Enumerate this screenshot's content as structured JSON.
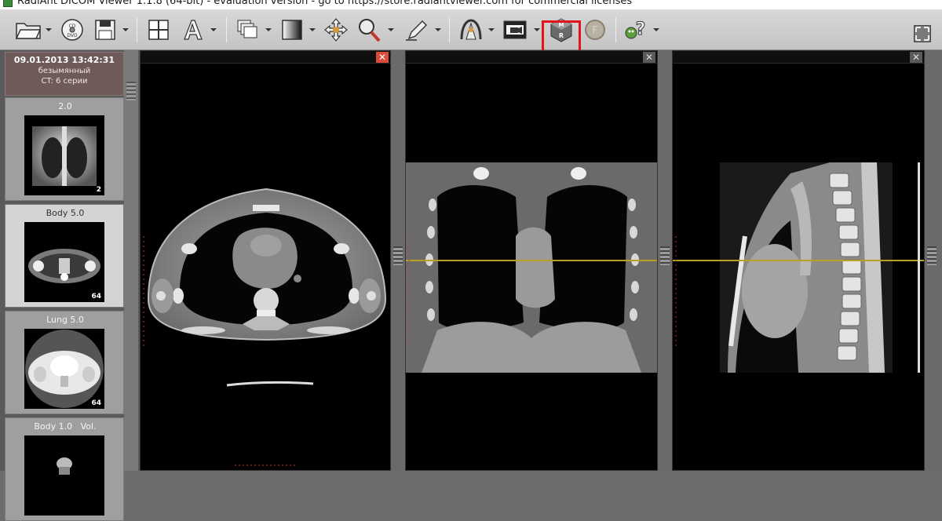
{
  "window": {
    "title": "RadiAnt DICOM Viewer 1.1.8 (64-bit) - evaluation version - go to https://store.radiantviewer.com for commercial licenses"
  },
  "toolbar": {
    "tools": [
      {
        "name": "open",
        "icon": "folder-icon"
      },
      {
        "name": "cd-dvd",
        "icon": "cd-dvd-icon"
      },
      {
        "name": "save",
        "icon": "floppy-icon"
      },
      {
        "name": "layout",
        "icon": "grid-layout-icon"
      },
      {
        "name": "annotation",
        "icon": "text-a-icon"
      },
      {
        "name": "series",
        "icon": "stack-icon"
      },
      {
        "name": "window-level",
        "icon": "gradient-icon"
      },
      {
        "name": "pan",
        "icon": "pan-arrows-icon"
      },
      {
        "name": "zoom",
        "icon": "magnifier-icon"
      },
      {
        "name": "draw",
        "icon": "pen-icon"
      },
      {
        "name": "3d",
        "icon": "3d-reconstruction-icon"
      },
      {
        "name": "cine",
        "icon": "film-icon"
      },
      {
        "name": "mpr",
        "icon": "mpr-cube-icon"
      },
      {
        "name": "fusion",
        "icon": "fusion-coin-icon"
      },
      {
        "name": "help",
        "icon": "help-question-icon"
      }
    ],
    "highlight_color": "#e0141c"
  },
  "study": {
    "date": "09.01.2013 13:42:31",
    "name": "безымянный",
    "series_summary": "CT: 6 серии"
  },
  "series": [
    {
      "label": "2.0",
      "count": "2",
      "kind": "scout"
    },
    {
      "label": "Body 5.0",
      "count": "64",
      "kind": "body-axial",
      "selected": true
    },
    {
      "label": "Lung 5.0",
      "count": "64",
      "kind": "lung-axial"
    },
    {
      "label": "Body 1.0   Vol.",
      "count": "",
      "kind": "body-volume"
    }
  ],
  "viewports": [
    {
      "name": "axial",
      "close": "✕",
      "active": true
    },
    {
      "name": "coronal",
      "close": "✕",
      "active": false
    },
    {
      "name": "sagittal",
      "close": "✕",
      "active": false
    }
  ],
  "colors": {
    "crosshair": "#b8a020",
    "ruler": "#c83a2a",
    "study_header": "#6e5a58"
  }
}
